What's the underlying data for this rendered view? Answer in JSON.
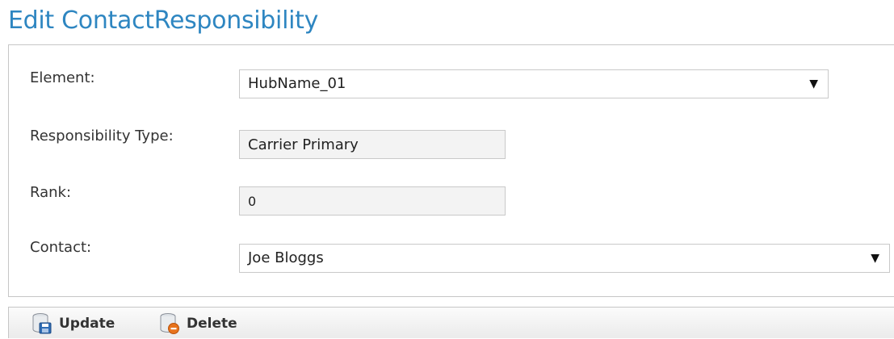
{
  "page": {
    "title": "Edit ContactResponsibility"
  },
  "form": {
    "element": {
      "label": "Element:",
      "value": "HubName_01"
    },
    "responsibility_type": {
      "label": "Responsibility Type:",
      "value": "Carrier Primary"
    },
    "rank": {
      "label": "Rank:",
      "value": "0"
    },
    "contact": {
      "label": "Contact:",
      "value": "Joe Bloggs"
    }
  },
  "toolbar": {
    "update_label": "Update",
    "delete_label": "Delete"
  },
  "icons": {
    "dropdown_arrow": "▼",
    "update": "database-save-icon",
    "delete": "database-delete-icon"
  },
  "colors": {
    "title": "#2e86c1",
    "border": "#c6c6c6",
    "field_bg": "#f3f3f3",
    "delete_accent": "#e8731c",
    "update_accent": "#2f6db5"
  }
}
